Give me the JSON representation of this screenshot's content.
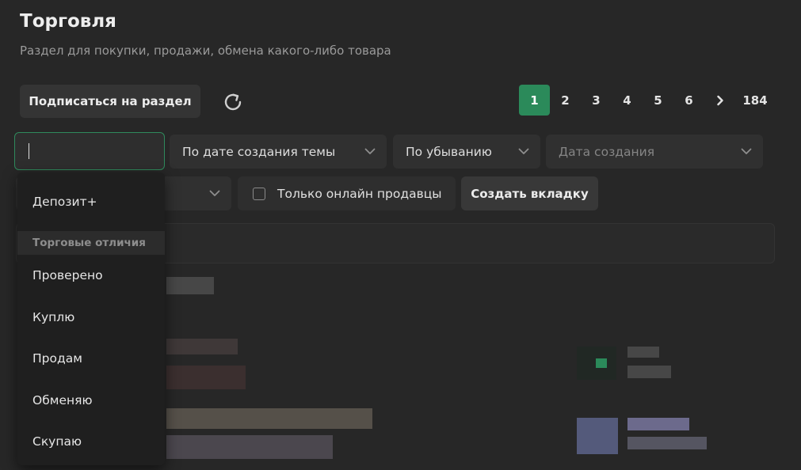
{
  "header": {
    "title": "Торговля",
    "subtitle": "Раздел для покупки, продажи, обмена какого-либо товара"
  },
  "toolbar": {
    "subscribe_label": "Подписаться на раздел",
    "refresh_icon": "refresh-icon"
  },
  "pagination": {
    "pages": [
      "1",
      "2",
      "3",
      "4",
      "5",
      "6"
    ],
    "active": "1",
    "next": "›",
    "last": "184"
  },
  "filters": {
    "search_value": "",
    "sort_by": "По дате создания темы",
    "order": "По убыванию",
    "date_placeholder": "Дата создания",
    "online_only_label": "Только онлайн продавцы",
    "online_only_checked": false,
    "create_tab_label": "Создать вкладку"
  },
  "dropdown": {
    "items_top": [
      "Депозит+"
    ],
    "group_header": "Торговые отличия",
    "items": [
      "Проверено",
      "Куплю",
      "Продам",
      "Обменяю",
      "Скупаю"
    ]
  },
  "colors": {
    "accent": "#2b8a5a",
    "background": "#272727",
    "field": "#303030"
  }
}
